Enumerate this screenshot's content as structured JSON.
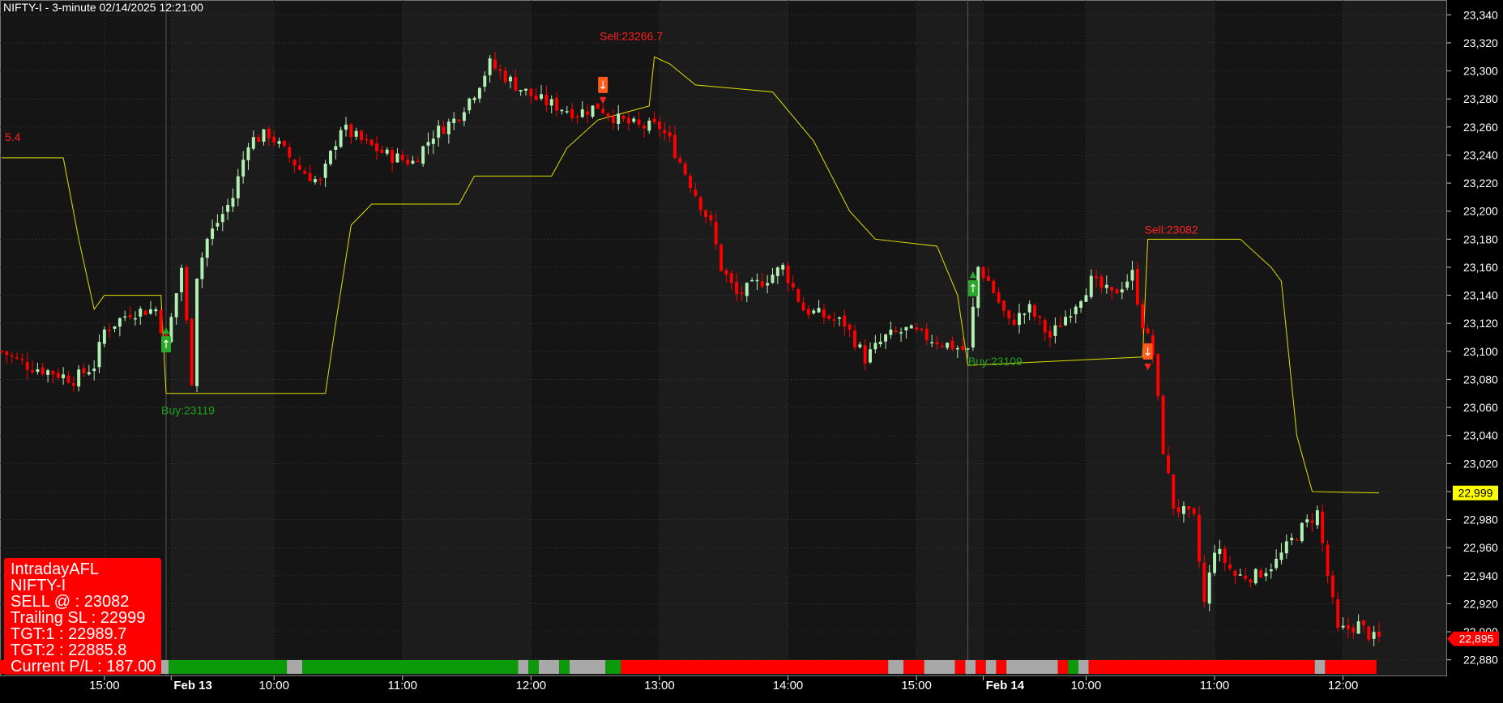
{
  "header": {
    "title": "NIFTY-I - 3-minute 02/14/2025 12:21:00"
  },
  "info_box": {
    "line1": " IntradayAFL",
    "line2": "NIFTY-I",
    "line3": "SELL @ : 23082",
    "line4": "Trailing SL : 22999",
    "line5": "TGT:1 : 22989.7",
    "line6": "TGT:2 : 22885.8",
    "line7": "Current P/L : 187.00"
  },
  "colors": {
    "background": "#000000",
    "panel": "#151515",
    "panel_alt": "#1c1c1c",
    "grid": "#3a3a3a",
    "up_candle": "#b3f0b3",
    "down_candle": "#ff0000",
    "stop_line": "#e0e000",
    "buy_text": "#1fa01f",
    "sell_text": "#ff2020",
    "ribbon_green": "#0a9a0a",
    "ribbon_red": "#ff0000",
    "ribbon_gray": "#a8a8a8"
  },
  "chart_data": {
    "type": "candlestick",
    "title": "NIFTY-I - 3-minute 02/14/2025 12:21:00",
    "ylim": [
      22870,
      23350
    ],
    "y_ticks": [
      22880,
      22900,
      22920,
      22940,
      22960,
      22980,
      23000,
      23020,
      23040,
      23060,
      23080,
      23100,
      23120,
      23140,
      23160,
      23180,
      23200,
      23220,
      23240,
      23260,
      23280,
      23300,
      23320,
      23340
    ],
    "y_tick_labels": [
      "22,880",
      "22,900",
      "22,920",
      "22,940",
      "22,960",
      "22,980",
      "23,000",
      "23,020",
      "23,040",
      "23,060",
      "23,080",
      "23,100",
      "23,120",
      "23,140",
      "23,160",
      "23,180",
      "23,200",
      "23,220",
      "23,240",
      "23,260",
      "23,280",
      "23,300",
      "23,320",
      "23,340"
    ],
    "x_range": [
      0,
      268
    ],
    "x_ticks": [
      {
        "x": 20,
        "label": "15:00",
        "bold": false
      },
      {
        "x": 33,
        "label": "Feb 13",
        "bold": true
      },
      {
        "x": 53,
        "label": "10:00",
        "bold": false
      },
      {
        "x": 78,
        "label": "11:00",
        "bold": false
      },
      {
        "x": 103,
        "label": "12:00",
        "bold": false
      },
      {
        "x": 128,
        "label": "13:00",
        "bold": false
      },
      {
        "x": 153,
        "label": "14:00",
        "bold": false
      },
      {
        "x": 178,
        "label": "15:00",
        "bold": false
      },
      {
        "x": 191,
        "label": "Feb 14",
        "bold": true
      },
      {
        "x": 211,
        "label": "10:00",
        "bold": false
      },
      {
        "x": 236,
        "label": "11:00",
        "bold": false
      },
      {
        "x": 261,
        "label": "12:00",
        "bold": false
      }
    ],
    "day_divider_x": [
      32,
      188
    ],
    "waypoints": [
      [
        0,
        23100
      ],
      [
        5,
        23090
      ],
      [
        10,
        23085
      ],
      [
        14,
        23080
      ],
      [
        18,
        23090
      ],
      [
        20,
        23115
      ],
      [
        25,
        23128
      ],
      [
        30,
        23130
      ],
      [
        32,
        23105
      ],
      [
        35,
        23160
      ],
      [
        37,
        23080
      ],
      [
        38,
        23155
      ],
      [
        40,
        23180
      ],
      [
        45,
        23210
      ],
      [
        48,
        23250
      ],
      [
        52,
        23255
      ],
      [
        58,
        23230
      ],
      [
        62,
        23220
      ],
      [
        66,
        23260
      ],
      [
        70,
        23250
      ],
      [
        75,
        23240
      ],
      [
        80,
        23235
      ],
      [
        84,
        23255
      ],
      [
        88,
        23265
      ],
      [
        92,
        23285
      ],
      [
        95,
        23305
      ],
      [
        100,
        23290
      ],
      [
        104,
        23280
      ],
      [
        108,
        23275
      ],
      [
        112,
        23270
      ],
      [
        116,
        23275
      ],
      [
        120,
        23265
      ],
      [
        124,
        23260
      ],
      [
        128,
        23260
      ],
      [
        130,
        23250
      ],
      [
        134,
        23220
      ],
      [
        138,
        23190
      ],
      [
        140,
        23160
      ],
      [
        143,
        23140
      ],
      [
        148,
        23150
      ],
      [
        152,
        23160
      ],
      [
        156,
        23130
      ],
      [
        160,
        23125
      ],
      [
        164,
        23120
      ],
      [
        168,
        23095
      ],
      [
        172,
        23110
      ],
      [
        176,
        23115
      ],
      [
        180,
        23110
      ],
      [
        184,
        23105
      ],
      [
        188,
        23100
      ],
      [
        190,
        23160
      ],
      [
        192,
        23150
      ],
      [
        196,
        23120
      ],
      [
        200,
        23130
      ],
      [
        204,
        23110
      ],
      [
        208,
        23130
      ],
      [
        212,
        23150
      ],
      [
        216,
        23140
      ],
      [
        220,
        23155
      ],
      [
        222,
        23120
      ],
      [
        224,
        23098
      ],
      [
        226,
        23030
      ],
      [
        228,
        22990
      ],
      [
        232,
        22980
      ],
      [
        234,
        22920
      ],
      [
        236,
        22960
      ],
      [
        240,
        22940
      ],
      [
        244,
        22940
      ],
      [
        248,
        22950
      ],
      [
        252,
        22970
      ],
      [
        256,
        22985
      ],
      [
        258,
        22940
      ],
      [
        260,
        22900
      ],
      [
        264,
        22905
      ],
      [
        267,
        22895
      ]
    ],
    "stop_line": [
      [
        0,
        23238
      ],
      [
        12,
        23238
      ],
      [
        15,
        23180
      ],
      [
        18,
        23130
      ],
      [
        20,
        23140
      ],
      [
        31,
        23140
      ],
      [
        32,
        23070
      ],
      [
        38,
        23070
      ],
      [
        63,
        23070
      ],
      [
        65,
        23120
      ],
      [
        68,
        23190
      ],
      [
        72,
        23205
      ],
      [
        89,
        23205
      ],
      [
        92,
        23225
      ],
      [
        107,
        23225
      ],
      [
        110,
        23245
      ],
      [
        116,
        23265
      ],
      [
        126,
        23275
      ],
      [
        127,
        23310
      ],
      [
        130,
        23305
      ],
      [
        135,
        23290
      ],
      [
        150,
        23285
      ],
      [
        158,
        23250
      ],
      [
        165,
        23200
      ],
      [
        170,
        23180
      ],
      [
        182,
        23175
      ],
      [
        186,
        23140
      ],
      [
        188,
        23090
      ],
      [
        222,
        23096
      ],
      [
        223,
        23180
      ],
      [
        241,
        23180
      ],
      [
        247,
        23160
      ],
      [
        249,
        23150
      ],
      [
        252,
        23040
      ],
      [
        255,
        23000
      ],
      [
        268,
        22999
      ]
    ],
    "signals": [
      {
        "type": "buy",
        "x": 32,
        "price": 23105,
        "label": "Buy:23119",
        "label_price": 23055
      },
      {
        "type": "sell",
        "x": 117,
        "price": 23290,
        "label": "Sell:23266.7",
        "label_price": 23322
      },
      {
        "type": "buy",
        "x": 189,
        "price": 23145,
        "label": "Buy:23109",
        "label_price": 23090
      },
      {
        "type": "sell",
        "x": 223,
        "price": 23100,
        "label": "Sell:23082",
        "label_price": 23184
      }
    ],
    "left_label": {
      "text": "5.4",
      "price": 23250
    },
    "current_price": {
      "value": 22895,
      "label": "22,895"
    },
    "stop_price": {
      "value": 22999,
      "label": "22,999"
    },
    "ribbon": [
      [
        0,
        30,
        "red"
      ],
      [
        30,
        33,
        "gray"
      ],
      [
        33,
        56,
        "green"
      ],
      [
        56,
        59,
        "gray"
      ],
      [
        59,
        101,
        "green"
      ],
      [
        101,
        103,
        "gray"
      ],
      [
        103,
        105,
        "green"
      ],
      [
        105,
        109,
        "gray"
      ],
      [
        109,
        111,
        "green"
      ],
      [
        111,
        118,
        "gray"
      ],
      [
        118,
        121,
        "green"
      ],
      [
        121,
        173,
        "red"
      ],
      [
        173,
        176,
        "gray"
      ],
      [
        176,
        180,
        "red"
      ],
      [
        180,
        186,
        "gray"
      ],
      [
        186,
        188,
        "red"
      ],
      [
        188,
        190,
        "gray"
      ],
      [
        190,
        192,
        "red"
      ],
      [
        192,
        194,
        "gray"
      ],
      [
        194,
        196,
        "red"
      ],
      [
        196,
        206,
        "gray"
      ],
      [
        206,
        208,
        "red"
      ],
      [
        208,
        210,
        "green"
      ],
      [
        210,
        212,
        "gray"
      ],
      [
        212,
        256,
        "red"
      ],
      [
        256,
        258,
        "gray"
      ],
      [
        258,
        268,
        "red"
      ]
    ]
  }
}
